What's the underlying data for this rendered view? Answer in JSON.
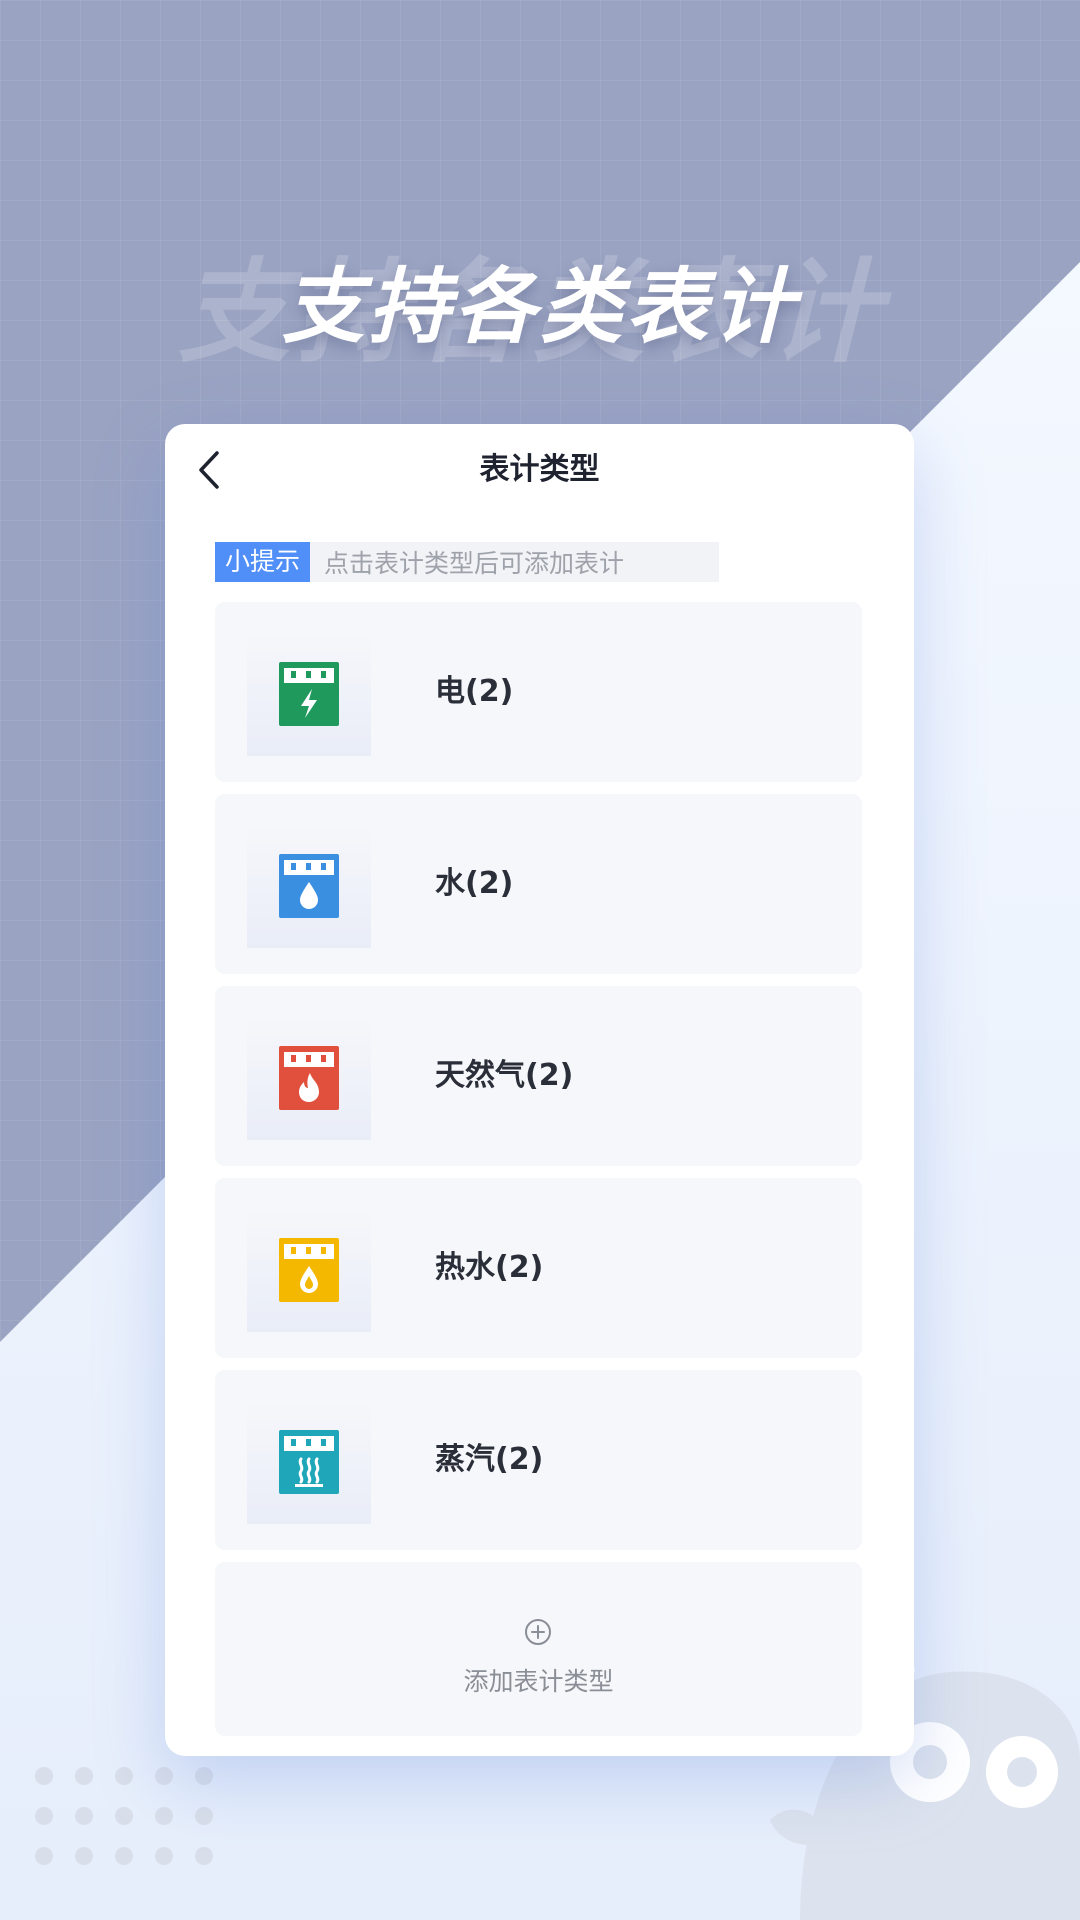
{
  "headline": "支持各类表计",
  "card": {
    "title": "表计类型",
    "tip_badge": "小提示",
    "tip_text": "点击表计类型后可添加表计"
  },
  "meter_types": [
    {
      "label": "电(2)",
      "icon": "electricity-meter-icon",
      "color": "#1f9a5c"
    },
    {
      "label": "水(2)",
      "icon": "water-meter-icon",
      "color": "#3a8fe0"
    },
    {
      "label": "天然气(2)",
      "icon": "gas-meter-icon",
      "color": "#e0503c"
    },
    {
      "label": "热水(2)",
      "icon": "hot-water-meter-icon",
      "color": "#f5b800"
    },
    {
      "label": "蒸汽(2)",
      "icon": "steam-meter-icon",
      "color": "#1fa6b8"
    }
  ],
  "add_type_label": "添加表计类型",
  "colors": {
    "accent": "#4f8ff7",
    "background_top": "#9aa4c4",
    "background_bottom": "#eef3fb"
  }
}
